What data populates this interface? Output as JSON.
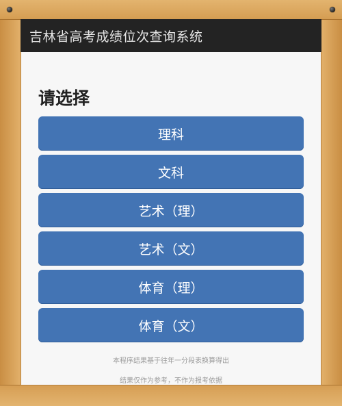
{
  "header": {
    "title": "吉林省高考成绩位次查询系统"
  },
  "main": {
    "heading": "请选择",
    "options": [
      {
        "label": "理科"
      },
      {
        "label": "文科"
      },
      {
        "label": "艺术（理）"
      },
      {
        "label": "艺术（文）"
      },
      {
        "label": "体育（理）"
      },
      {
        "label": "体育（文）"
      }
    ]
  },
  "footer": {
    "line1": "本程序结果基于往年一分段表换算得出",
    "line2": "结果仅作为参考，不作为报考依据"
  },
  "colors": {
    "accent": "#4374b4",
    "titlebar": "#232323",
    "frame": "#d8a45a"
  }
}
